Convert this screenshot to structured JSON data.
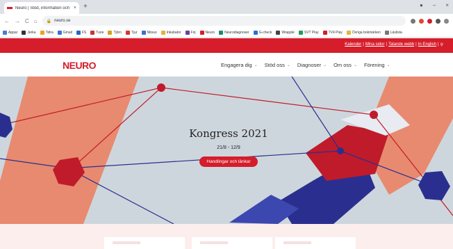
{
  "browser": {
    "tab_title": "Neuro | Stöd, information och gemenskap",
    "tab_close": "×",
    "new_tab": "+",
    "window_controls": [
      "●",
      "–",
      "×"
    ],
    "nav": [
      "←",
      "→",
      "C",
      "⌂"
    ],
    "url": "neuro.se",
    "bookmarks": [
      "Appar",
      "Jerka",
      "Tidra",
      "Gmail",
      "FS",
      "Tune",
      "Tjörn",
      "Tjur",
      "Nitsuo",
      "Inkubator",
      "Fnj",
      "Neuro",
      "Neurodiagnoser",
      "G-check",
      "Wrapple",
      "SVT Play",
      "TV4 Play",
      "Övriga bokmärken",
      "Läslista"
    ],
    "colors": {
      "accent": "#d51d2b"
    }
  },
  "site": {
    "top_links": [
      "Kalender",
      "Mina sidor",
      "Talande webb",
      "In English"
    ],
    "top_sep": "|",
    "search_icon": "search-icon",
    "logo": "NEURO",
    "nav": [
      {
        "label": "Engagera dig"
      },
      {
        "label": "Stöd oss"
      },
      {
        "label": "Diagnoser"
      },
      {
        "label": "Om oss"
      },
      {
        "label": "Förening"
      }
    ],
    "chevron": "⌄",
    "hero": {
      "title": "Kongress 2021",
      "dates": "21/8 - 12/9",
      "cta": "Handlingar och länkar"
    }
  }
}
